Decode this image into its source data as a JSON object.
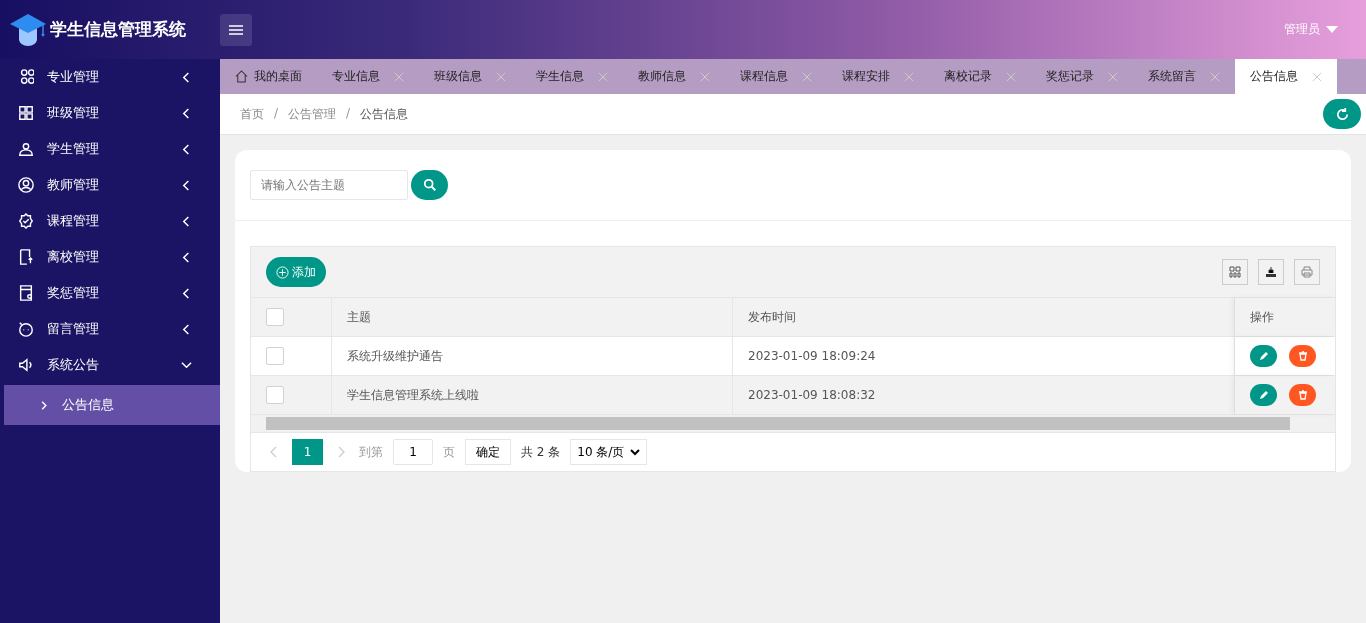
{
  "header": {
    "title": "学生信息管理系统",
    "user": "管理员"
  },
  "sidebar": {
    "items": [
      {
        "label": "专业管理",
        "expanded": false
      },
      {
        "label": "班级管理",
        "expanded": false
      },
      {
        "label": "学生管理",
        "expanded": false
      },
      {
        "label": "教师管理",
        "expanded": false
      },
      {
        "label": "课程管理",
        "expanded": false
      },
      {
        "label": "离校管理",
        "expanded": false
      },
      {
        "label": "奖惩管理",
        "expanded": false
      },
      {
        "label": "留言管理",
        "expanded": false
      },
      {
        "label": "系统公告",
        "expanded": true,
        "children": [
          {
            "label": "公告信息",
            "selected": true
          }
        ]
      }
    ]
  },
  "tabs": [
    {
      "label": "我的桌面",
      "kind": "home",
      "selected": false
    },
    {
      "label": "专业信息",
      "kind": "page",
      "selected": false
    },
    {
      "label": "班级信息",
      "kind": "page",
      "selected": false
    },
    {
      "label": "学生信息",
      "kind": "page",
      "selected": false
    },
    {
      "label": "教师信息",
      "kind": "page",
      "selected": false
    },
    {
      "label": "课程信息",
      "kind": "page",
      "selected": false
    },
    {
      "label": "课程安排",
      "kind": "page",
      "selected": false
    },
    {
      "label": "离校记录",
      "kind": "page",
      "selected": false
    },
    {
      "label": "奖惩记录",
      "kind": "page",
      "selected": false
    },
    {
      "label": "系统留言",
      "kind": "page",
      "selected": false
    },
    {
      "label": "公告信息",
      "kind": "page",
      "selected": true
    }
  ],
  "breadcrumb": {
    "separator": "/",
    "items": [
      "首页",
      "公告管理",
      "公告信息"
    ]
  },
  "search": {
    "placeholder": "请输入公告主题"
  },
  "toolbar": {
    "add_label": "添加"
  },
  "table": {
    "select_all_checked": false,
    "columns": [
      "主题",
      "发布时间",
      "操作"
    ],
    "rows": [
      {
        "checked": false,
        "highlighted": false,
        "cells": [
          "系统升级维护通告",
          "2023-01-09 18:09:24"
        ]
      },
      {
        "checked": false,
        "highlighted": true,
        "cells": [
          "学生信息管理系统上线啦",
          "2023-01-09 18:08:32"
        ]
      }
    ]
  },
  "pagination": {
    "pages": [
      {
        "label": "1",
        "selected": true
      }
    ],
    "goto_label": "到第",
    "page_value": "1",
    "page_unit": "页",
    "confirm": "确定",
    "total": "共 2 条",
    "page_size": "10 条/页"
  }
}
